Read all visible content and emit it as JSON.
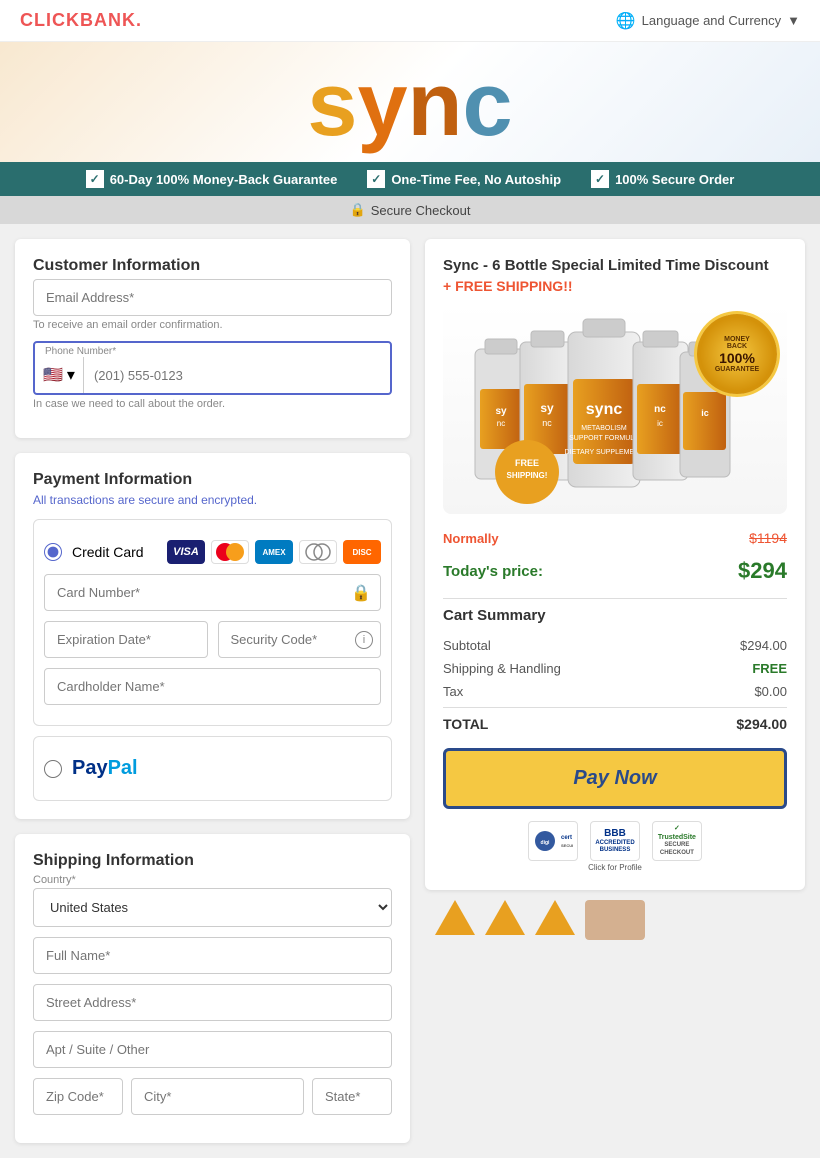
{
  "header": {
    "logo": "CLICKBANK.",
    "lang_currency": "Language and Currency"
  },
  "hero": {
    "logo_text": "sync"
  },
  "banner": {
    "items": [
      "60-Day 100% Money-Back Guarantee",
      "One-Time Fee, No Autoship",
      "100% Secure Order"
    ]
  },
  "secure_bar": {
    "text": "Secure Checkout"
  },
  "customer_info": {
    "title": "Customer Information",
    "email_label": "Email Address*",
    "email_hint": "To receive an email order confirmation.",
    "phone_label": "Phone Number*",
    "phone_placeholder": "(201) 555-0123",
    "phone_hint": "In case we need to call about the order.",
    "flag": "🇺🇸"
  },
  "payment": {
    "title": "Payment Information",
    "subtitle": "All transactions are secure and encrypted.",
    "credit_card_label": "Credit Card",
    "card_number_label": "Card Number*",
    "expiration_label": "Expiration Date*",
    "security_code_label": "Security Code*",
    "cardholder_label": "Cardholder Name*",
    "paypal_alt": "PayPal"
  },
  "shipping": {
    "title": "Shipping Information",
    "country_label": "Country*",
    "country_value": "United States",
    "fullname_label": "Full Name*",
    "street_label": "Street Address*",
    "apt_label": "Apt / Suite / Other",
    "zip_label": "Zip Code*",
    "city_label": "City*",
    "state_label": "State*"
  },
  "product": {
    "title": "Sync - 6 Bottle Special Limited Time Discount",
    "free_shipping": "+ FREE SHIPPING!!",
    "normally_label": "Normally",
    "normally_price": "$1194",
    "today_label": "Today's price:",
    "today_price": "$294",
    "free_ship_badge_line1": "FREE",
    "free_ship_badge_line2": "SHIPPING!",
    "money_back_line1": "MONEY",
    "money_back_line2": "BACK",
    "money_back_line3": "100%",
    "money_back_line4": "GUARANTEE"
  },
  "cart": {
    "title": "Cart Summary",
    "subtotal_label": "Subtotal",
    "subtotal_value": "$294.00",
    "shipping_label": "Shipping & Handling",
    "shipping_value": "FREE",
    "tax_label": "Tax",
    "tax_value": "$0.00",
    "total_label": "TOTAL",
    "total_value": "$294.00",
    "pay_button": "Pay Now"
  },
  "trust": {
    "digicert": "digicert",
    "bbb": "BBB ACCREDITED BUSINESS Click for Profile",
    "trustedsite": "TrustedSite SECURE CHECKOUT"
  }
}
